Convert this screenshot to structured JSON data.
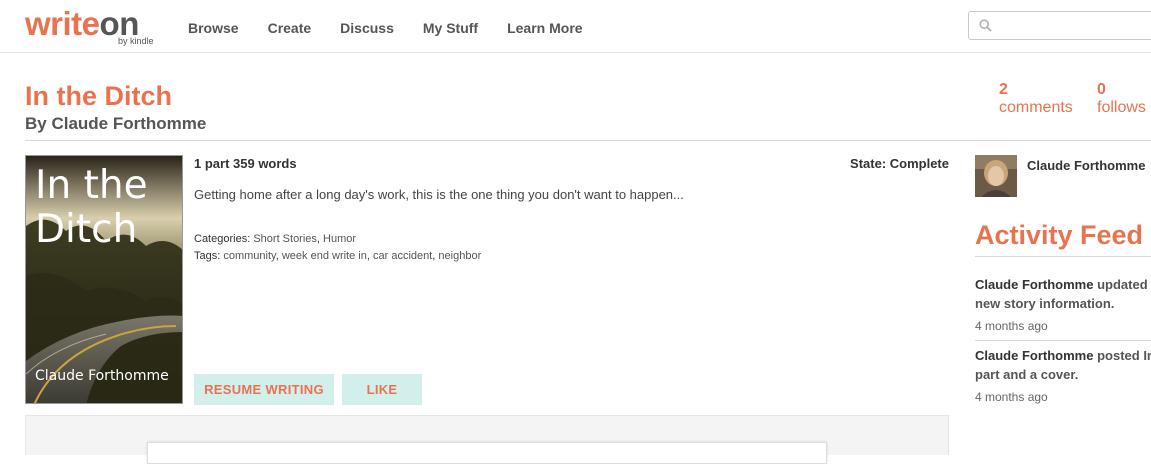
{
  "header": {
    "logo_main": "write",
    "logo_dark": "on",
    "logo_sub": "by kindle",
    "nav": [
      "Browse",
      "Create",
      "Discuss",
      "My Stuff",
      "Learn More"
    ],
    "search_placeholder": ""
  },
  "story": {
    "title": "In the Ditch",
    "author_line": "By Claude Forthomme",
    "comments_count": "2",
    "comments_label": "comments",
    "follows_count": "0",
    "follows_label": "follows",
    "cover_title": "In the Ditch",
    "cover_author": "Claude Forthomme",
    "parts_words": "1 part 359 words",
    "state": "State: Complete",
    "summary": "Getting home after a long day's work, this is the one thing you don't want to happen...",
    "categories_label": "Categories:",
    "categories": [
      "Short Stories",
      "Humor"
    ],
    "tags_label": "Tags:",
    "tags": [
      "community",
      "week end write in",
      "car accident",
      "neighbor"
    ],
    "resume_label": "RESUME WRITING",
    "like_label": "LIKE"
  },
  "sidebar": {
    "author_name": "Claude Forthomme",
    "activity_heading": "Activity Feed",
    "feed": [
      {
        "who": "Claude Forthomme",
        "action": "updated",
        "line2": "new story information.",
        "time": "4 months ago"
      },
      {
        "who": "Claude Forthomme",
        "action": "posted In",
        "line2": "part and a cover.",
        "time": "4 months ago"
      }
    ]
  },
  "colors": {
    "accent": "#e8734f",
    "button_bg": "#d3efec"
  }
}
